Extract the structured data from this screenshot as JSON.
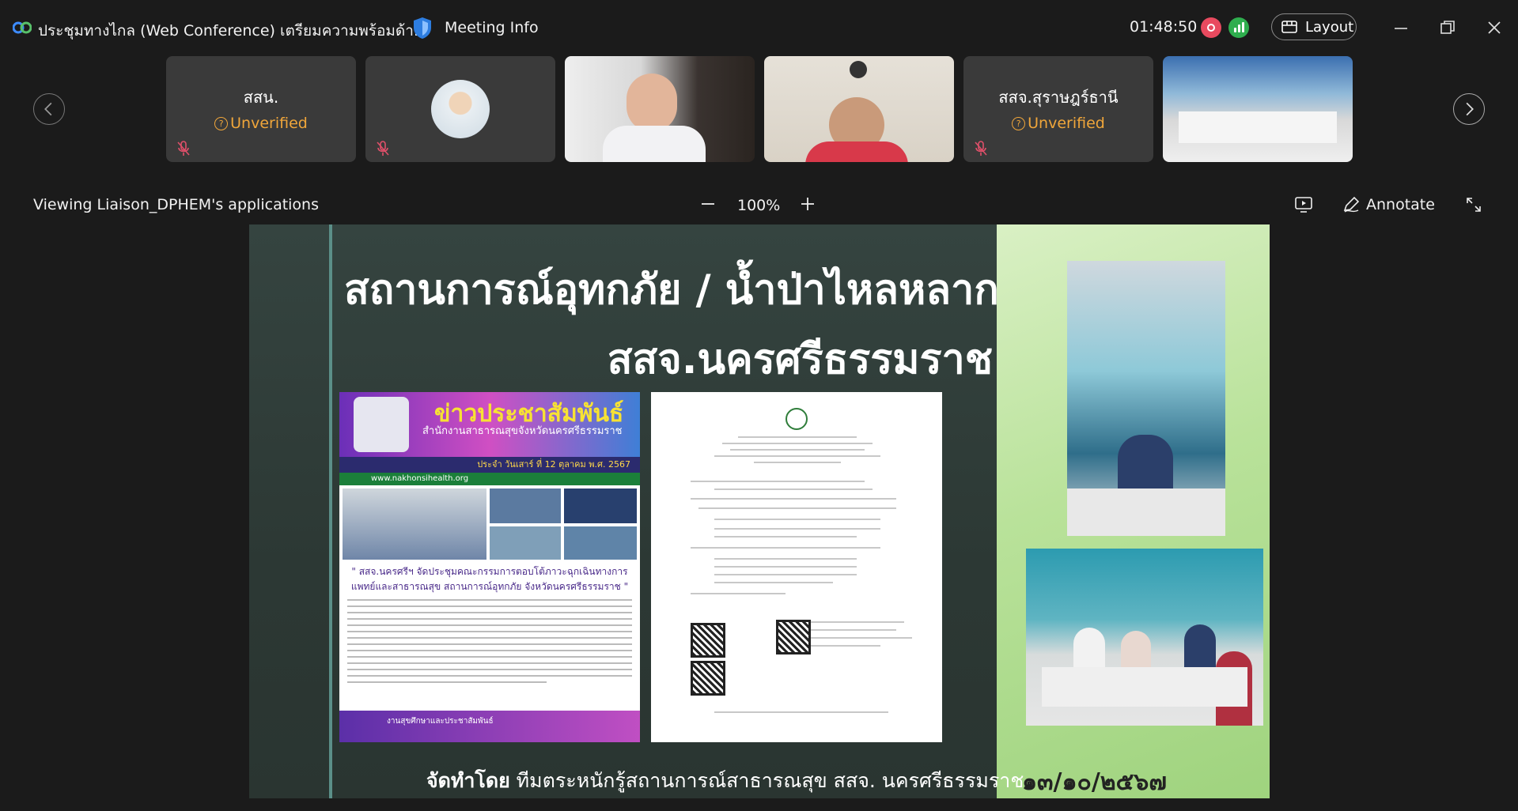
{
  "titlebar": {
    "meeting_title": "ประชุมทางไกล (Web Conference) เตรียมความพร้อมด้า...",
    "meeting_info_label": "Meeting Info",
    "clock": "01:48:50",
    "layout_label": "Layout"
  },
  "participants": [
    {
      "name": "สสน.",
      "status": "Unverified"
    },
    {
      "name": "สสจ.สุราษฎร์ธานี",
      "status": "Unverified"
    }
  ],
  "toolbar": {
    "viewing_label": "Viewing Liaison_DPHEM's applications",
    "zoom": "100%",
    "annotate_label": "Annotate"
  },
  "slide": {
    "title_line1": "สถานการณ์อุทกภัย / น้ำป่าไหลหลาก",
    "title_line2": "สสจ.นครศรีธรรมราช",
    "poster_heading": "ข่าวประชาสัมพันธ์",
    "poster_subheading": "สำนักงานสาธารณสุขจังหวัดนครศรีธรรมราช",
    "poster_date": "ประจำ วันเสาร์ ที่ 12 ตุลาคม พ.ศ. 2567",
    "poster_web": "www.nakhonsihealth.org",
    "poster_caption": "\" สสจ.นครศรีฯ จัดประชุมคณะกรรมการตอบโต้ภาวะฉุกเฉินทางการแพทย์และสาธารณสุข สถานการณ์อุทกภัย จังหวัดนครศรีธรรมราช \"",
    "poster_footer": "งานสุขศึกษาและประชาสัมพันธ์",
    "credit_prefix": "จัดทำโดย",
    "credit_text": "ทีมตระหนักรู้สถานการณ์สาธารณสุข สสจ. นครศรีธรรมราช",
    "date": "๑๓/๑๐/๒๕๖๗"
  }
}
